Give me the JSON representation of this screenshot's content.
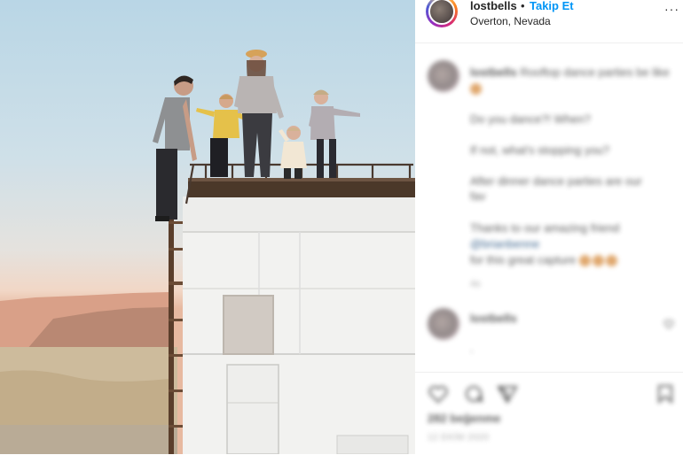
{
  "post": {
    "username": "lostbells",
    "separator": "•",
    "follow_label": "Takip Et",
    "location": "Overton, Nevada",
    "more_icon": "more-options-icon"
  },
  "caption": {
    "username": "lostbells",
    "line1": "Rooftop dance parties be like",
    "line2": "Do you dance?! When?",
    "line3": "If not, what's stopping you?",
    "line4a": "After dinner dance parties are our",
    "line4b": "fav",
    "line5a": "Thanks to our amazing friend",
    "line5b": "@brianbenne",
    "line5c": "for this great capture",
    "line6": "4s"
  },
  "comment": {
    "username": "lostbells",
    "text": "."
  },
  "actions": {
    "likes": "282 beğenme",
    "date": "12 EKİM 2020"
  },
  "colors": {
    "follow": "#0095f6",
    "text": "#262626",
    "muted": "#8e8e8e"
  }
}
